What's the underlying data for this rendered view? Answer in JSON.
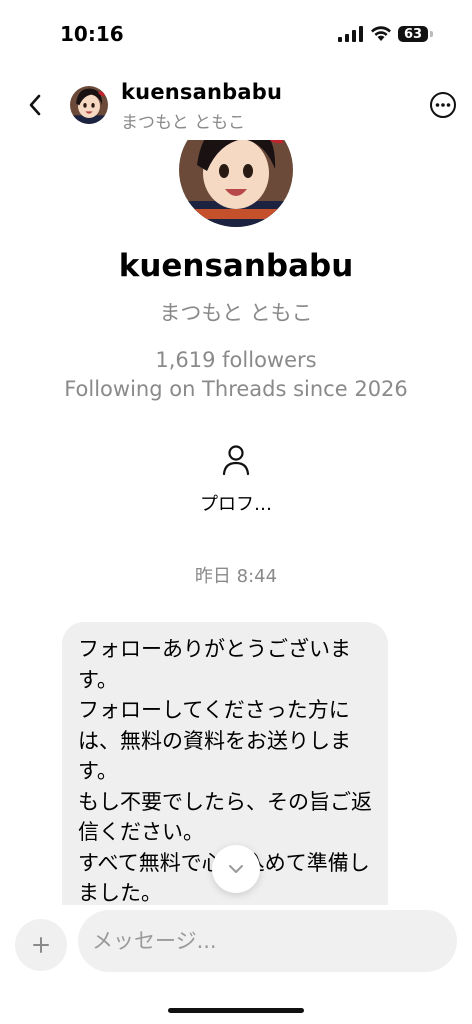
{
  "status": {
    "time": "10:16",
    "battery": "63"
  },
  "header": {
    "username": "kuensanbabu",
    "name": "まつもと ともこ"
  },
  "profile": {
    "username": "kuensanbabu",
    "name": "まつもと ともこ",
    "followers": "1,619 followers",
    "following": "Following on Threads since 2026",
    "profile_button_label": "プロフ…"
  },
  "chat": {
    "timestamp": "昨日 8:44",
    "message": "フォローありがとうございます。\nフォローしてくださった方には、無料の資料をお送りします。\nもし不要でしたら、その旨ご返信ください。\nすべて無料で心を込めて準備しました。"
  },
  "composer": {
    "placeholder": "メッセージ..."
  },
  "icons": [
    "back-icon",
    "more-icon",
    "person-icon",
    "chevron-down-icon",
    "plus-icon",
    "signal-icon",
    "wifi-icon",
    "battery-icon"
  ],
  "colors": {
    "secondary_text": "#8a8a8a",
    "bubble": "#efefef",
    "input_bg": "#f0f0f0"
  }
}
